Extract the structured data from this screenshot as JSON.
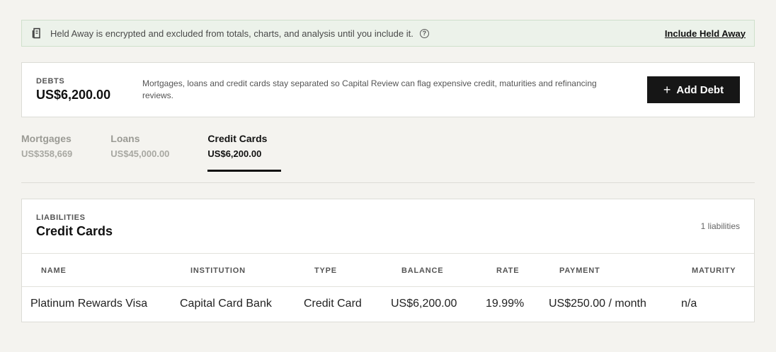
{
  "banner": {
    "message": "Held Away is encrypted and excluded from totals, charts, and analysis until you include it.",
    "link_label": "Include Held Away",
    "icon": "document-lock-icon",
    "help_icon": "question-circle-icon"
  },
  "debts": {
    "kicker": "DEBTS",
    "total": "US$6,200.00",
    "description": "Mortgages, loans and credit cards stay separated so Capital Review can flag expensive credit, maturities and refinancing reviews.",
    "add_label": "Add Debt",
    "add_icon": "plus-icon"
  },
  "tabs": [
    {
      "label": "Mortgages",
      "value": "US$358,669",
      "active": false
    },
    {
      "label": "Loans",
      "value": "US$45,000.00",
      "active": false
    },
    {
      "label": "Credit Cards",
      "value": "US$6,200.00",
      "active": true
    }
  ],
  "liabilities": {
    "kicker": "LIABILITIES",
    "title": "Credit Cards",
    "count": "1 liabilities",
    "columns": [
      "NAME",
      "INSTITUTION",
      "TYPE",
      "BALANCE",
      "RATE",
      "PAYMENT",
      "MATURITY"
    ],
    "rows": [
      [
        "Platinum Rewards Visa",
        "Capital Card Bank",
        "Credit Card",
        "US$6,200.00",
        "19.99%",
        "US$250.00 / month",
        "n/a"
      ]
    ]
  },
  "colors": {
    "background": "#f4f3ef",
    "banner_bg": "#ecf2ea",
    "button_bg": "#161616",
    "active_tab": "#111111",
    "inactive_tab": "#9a9a94"
  }
}
